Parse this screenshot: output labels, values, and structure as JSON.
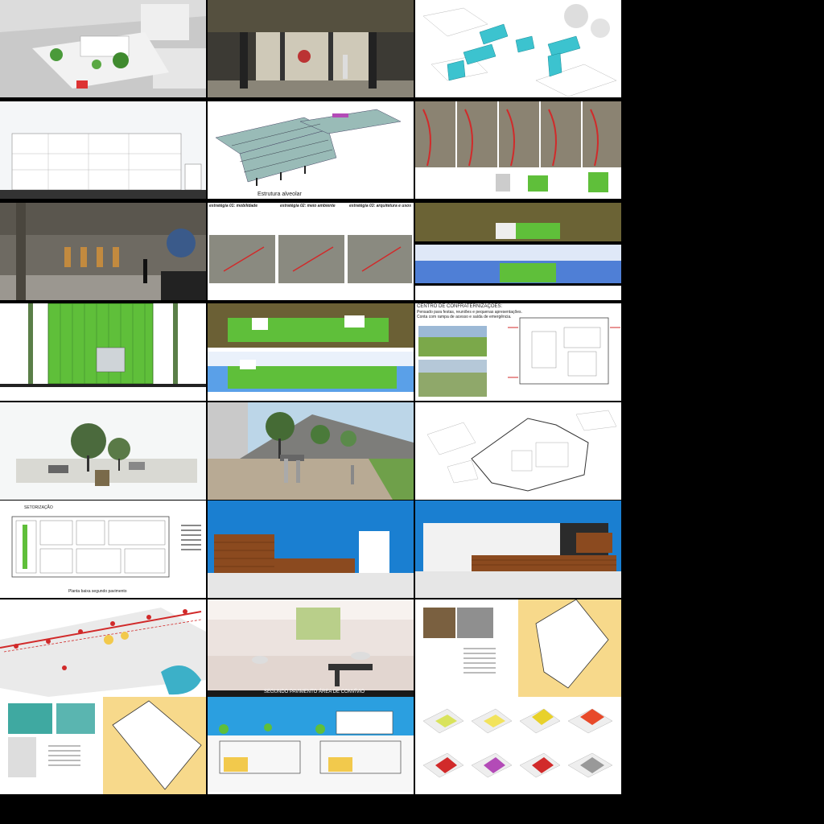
{
  "tiles": {
    "t04": {
      "caption": "Estrutura alveolar"
    },
    "t06": {
      "col1_title": "estratégia 01: mobilidade",
      "col2_title": "estratégia 02: meio ambiente",
      "col3_title": "estratégia 03: arquitetura e usos"
    },
    "t08": {
      "title": "CENTRO DE CONFRATERNIZAÇÕES:",
      "subtitle1": "Pensado para festas, reuniões e pequenas apresentações.",
      "subtitle2": "Conta com rampa de acesso e saída de emergência."
    },
    "t12": {
      "label_top": "SETORIZAÇÃO",
      "caption": "Planta baixa segundo pavimento"
    },
    "t19": {
      "caption": "SEGUNDO PAVIMENTO ÁREA DE CONVÍVIO"
    }
  },
  "colors": {
    "background": "#000000",
    "green": "#5fbf3a",
    "cyan": "#3cc3cf",
    "sky": "#1a7fd1",
    "brick": "#8b4a1f",
    "red": "#d12a2a",
    "yellow_plan": "#f7d98b"
  }
}
